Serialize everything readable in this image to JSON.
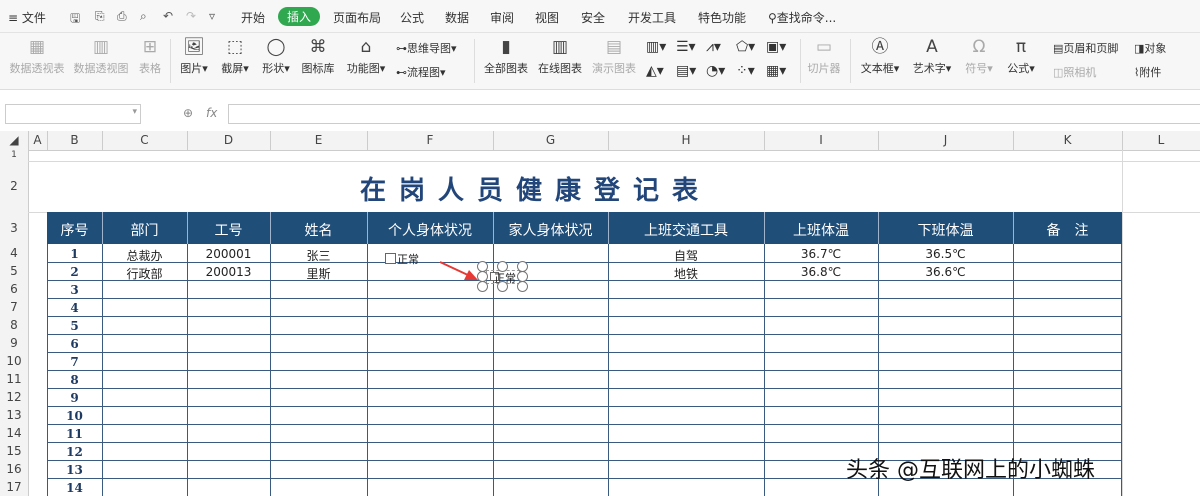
{
  "menubar": {
    "file_label": "文件",
    "quick_access": [
      "↶",
      "↷",
      "▿"
    ],
    "tabs": [
      "开始",
      "插入",
      "页面布局",
      "公式",
      "数据",
      "审阅",
      "视图",
      "安全",
      "开发工具",
      "特色功能"
    ],
    "active_tab": "插入",
    "search_label": "查找命令..."
  },
  "ribbon": {
    "pivot_table": "数据透视表",
    "pivot_chart": "数据透视图",
    "table": "表格",
    "picture": "图片",
    "screenshot": "截屏",
    "shapes": "形状",
    "icon_library": "图标库",
    "function_chart": "功能图",
    "mind_map": "思维导图",
    "flowchart": "流程图",
    "all_charts": "全部图表",
    "online_charts": "在线图表",
    "demo_charts": "演示图表",
    "slicer": "切片器",
    "textbox": "文本框",
    "wordart": "艺术字",
    "symbol": "符号",
    "formula": "公式",
    "header_footer": "页眉和页脚",
    "camera": "照相机",
    "object": "对象",
    "attachment": "附件"
  },
  "formula_bar": {
    "fx_label": "fx",
    "value": ""
  },
  "columns": [
    "A",
    "B",
    "C",
    "D",
    "E",
    "F",
    "G",
    "H",
    "I",
    "J",
    "K",
    "L"
  ],
  "rows": [
    "1",
    "2",
    "3",
    "4",
    "5",
    "6",
    "7",
    "8",
    "9",
    "10",
    "11",
    "12",
    "13",
    "14",
    "15",
    "16",
    "17"
  ],
  "sheet": {
    "title": "在岗人员健康登记表",
    "headers": [
      "序号",
      "部门",
      "工号",
      "姓名",
      "个人身体状况",
      "家人身体状况",
      "上班交通工具",
      "上班体温",
      "下班体温",
      "备　注"
    ],
    "records": [
      {
        "no": "1",
        "dept": "总裁办",
        "id": "200001",
        "name": "张三",
        "transport": "自驾",
        "temp_in": "36.7℃",
        "temp_out": "36.5℃"
      },
      {
        "no": "2",
        "dept": "行政部",
        "id": "200013",
        "name": "里斯",
        "transport": "地铁",
        "temp_in": "36.8℃",
        "temp_out": "36.6℃"
      }
    ],
    "row_numbers": [
      "3",
      "4",
      "5",
      "6",
      "7",
      "8",
      "9",
      "10",
      "11",
      "12",
      "13",
      "14"
    ],
    "checkbox_label": "正常",
    "selected_checkbox_label": "正常"
  },
  "watermark": "头条 @互联网上的小蜘蛛",
  "colors": {
    "header_bg": "#1f4e79",
    "title": "#22467a",
    "active_tab": "#2fa84f",
    "arrow": "#e53935"
  }
}
